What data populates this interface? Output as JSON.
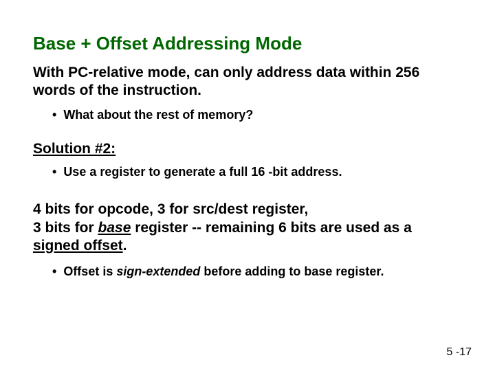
{
  "title": "Base + Offset Addressing Mode",
  "intro": "With PC-relative mode, can only address data within 256 words of the instruction.",
  "bullet_dot": "•",
  "bullets1": [
    "What about the rest of memory?"
  ],
  "solution_heading": "Solution #2:",
  "bullets2": [
    "Use a register to generate a full 16 -bit address."
  ],
  "bits": {
    "line1_pre": "4 bits for opcode, 3 for src/dest register,",
    "line2_pre": "3 bits for ",
    "base": "base",
    "line2_mid": " register -- remaining 6 bits are used as a ",
    "signed_offset": "signed offset",
    "period": "."
  },
  "offset_bullet": {
    "pre": "Offset is ",
    "em": "sign-extended",
    "post": " before adding to base register."
  },
  "page_number": "5 -17"
}
